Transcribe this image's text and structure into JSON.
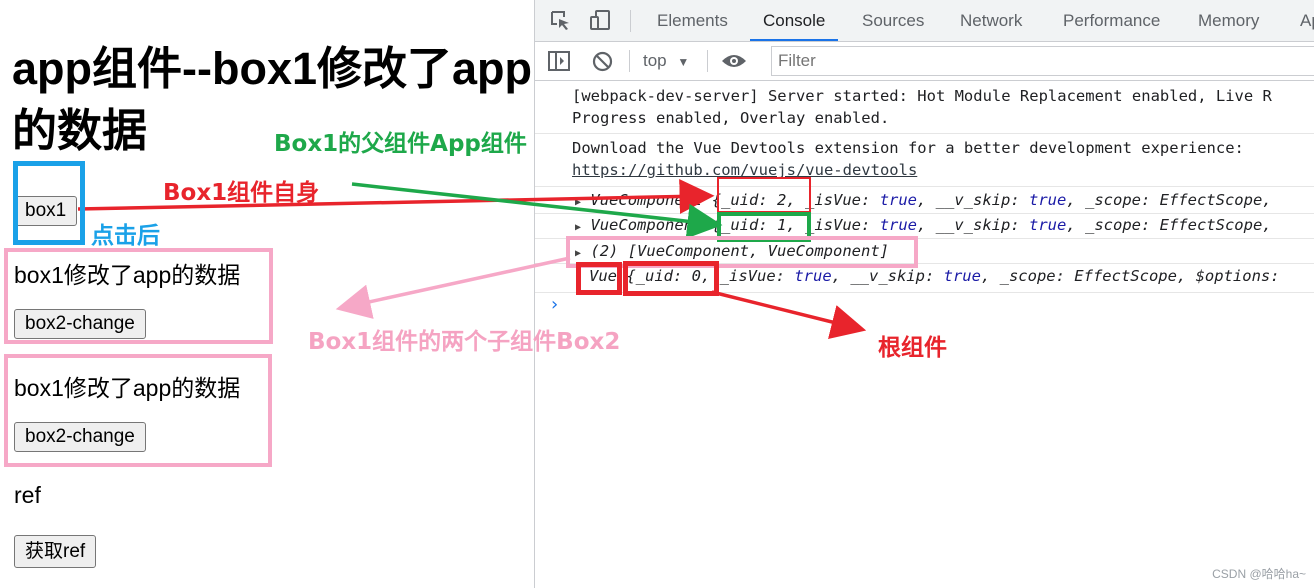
{
  "app": {
    "title": "app组件--box1修改了app的数据",
    "box1_button": "box1",
    "box2_a": {
      "text": "box1修改了app的数据",
      "button": "box2-change"
    },
    "box2_b": {
      "text": "box1修改了app的数据",
      "button": "box2-change"
    },
    "ref_label": "ref",
    "ref_button": "获取ref"
  },
  "devtools": {
    "tabs": [
      "Elements",
      "Console",
      "Sources",
      "Network",
      "Performance",
      "Memory",
      "Ap"
    ],
    "active_tab": "Console",
    "toolbar": {
      "context": "top",
      "filter_placeholder": "Filter"
    },
    "console": {
      "line1a": "[webpack-dev-server] Server started: Hot Module Replacement enabled, Live R",
      "line1b": "Progress enabled, Overlay enabled.",
      "line2a": "Download the Vue Devtools extension for a better development experience:",
      "line2b": "https://github.com/vuejs/vue-devtools",
      "row1": {
        "type": "VueComponent",
        "uid": "2"
      },
      "row2": {
        "type": "VueComponent",
        "uid": "1"
      },
      "row3": "(2) [VueComponent, VueComponent]",
      "row4": {
        "type": "Vue",
        "uid": "0"
      },
      "prompt": "›"
    }
  },
  "annotations": {
    "parent_app": "Box1的父组件App组件",
    "box1_self": "Box1组件自身",
    "after_click": "点击后",
    "two_children": "Box1组件的两个子组件Box2",
    "root": "根组件",
    "colors": {
      "green": "#1ea84a",
      "red": "#e8242c",
      "blue": "#1aa1e8",
      "pink": "#f6a8c7",
      "text_pink": "#f5a3c2"
    }
  },
  "watermark": "CSDN @哈哈ha~"
}
